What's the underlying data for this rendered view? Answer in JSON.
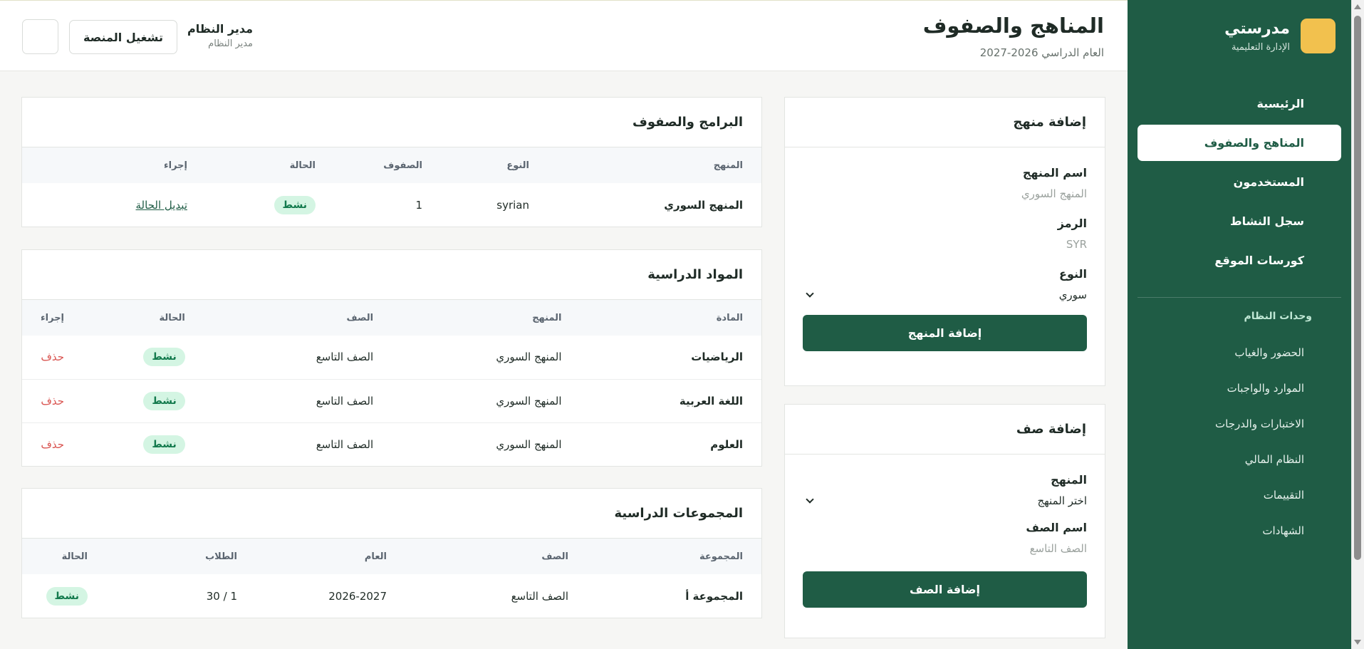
{
  "sidebar": {
    "brand_name": "مدرستي",
    "brand_sub": "الإدارة التعليمية",
    "nav": [
      {
        "label": "الرئيسية"
      },
      {
        "label": "المناهج والصفوف"
      },
      {
        "label": "المستخدمون"
      },
      {
        "label": "سجل النشاط"
      },
      {
        "label": "كورسات الموقع"
      }
    ],
    "section_title": "وحدات النظام",
    "sub_nav": [
      {
        "label": "الحضور والغياب"
      },
      {
        "label": "الموارد والواجبات"
      },
      {
        "label": "الاختبارات والدرجات"
      },
      {
        "label": "النظام المالي"
      },
      {
        "label": "التقييمات"
      },
      {
        "label": "الشهادات"
      }
    ]
  },
  "header": {
    "title": "المناهج والصفوف",
    "subtitle": "العام الدراسي 2026-2027",
    "user_name": "مدير النظام",
    "user_role": "مدير النظام",
    "run_button": "تشغيل المنصة"
  },
  "add_curriculum": {
    "title": "إضافة منهج",
    "name_label": "اسم المنهج",
    "name_placeholder": "المنهج السوري",
    "code_label": "الرمز",
    "code_placeholder": "SYR",
    "type_label": "النوع",
    "type_value": "سوري",
    "submit": "إضافة المنهج"
  },
  "add_grade": {
    "title": "إضافة صف",
    "curriculum_label": "المنهج",
    "curriculum_value": "اختر المنهج",
    "name_label": "اسم الصف",
    "name_placeholder": "الصف التاسع",
    "submit": "إضافة الصف"
  },
  "programs": {
    "title": "البرامج والصفوف",
    "columns": [
      "المنهج",
      "النوع",
      "الصفوف",
      "الحالة",
      "إجراء"
    ],
    "rows": [
      {
        "name": "المنهج السوري",
        "type": "syrian",
        "grades": "1",
        "status": "نشط",
        "action": "تبديل الحالة"
      }
    ]
  },
  "subjects": {
    "title": "المواد الدراسية",
    "columns": [
      "المادة",
      "المنهج",
      "الصف",
      "الحالة",
      "إجراء"
    ],
    "rows": [
      {
        "name": "الرياضيات",
        "curriculum": "المنهج السوري",
        "grade": "الصف التاسع",
        "status": "نشط",
        "action": "حذف"
      },
      {
        "name": "اللغة العربية",
        "curriculum": "المنهج السوري",
        "grade": "الصف التاسع",
        "status": "نشط",
        "action": "حذف"
      },
      {
        "name": "العلوم",
        "curriculum": "المنهج السوري",
        "grade": "الصف التاسع",
        "status": "نشط",
        "action": "حذف"
      }
    ]
  },
  "groups": {
    "title": "المجموعات الدراسية",
    "columns": [
      "المجموعة",
      "الصف",
      "العام",
      "الطلاب",
      "الحالة"
    ],
    "rows": [
      {
        "name": "المجموعة أ",
        "grade": "الصف التاسع",
        "year": "2026-2027",
        "students": "1 / 30",
        "status": "نشط"
      }
    ]
  },
  "colors": {
    "brand": "#1f5c45",
    "accent": "#f2c14e",
    "badge_bg": "#d4f5e3",
    "danger": "#d9534f"
  }
}
